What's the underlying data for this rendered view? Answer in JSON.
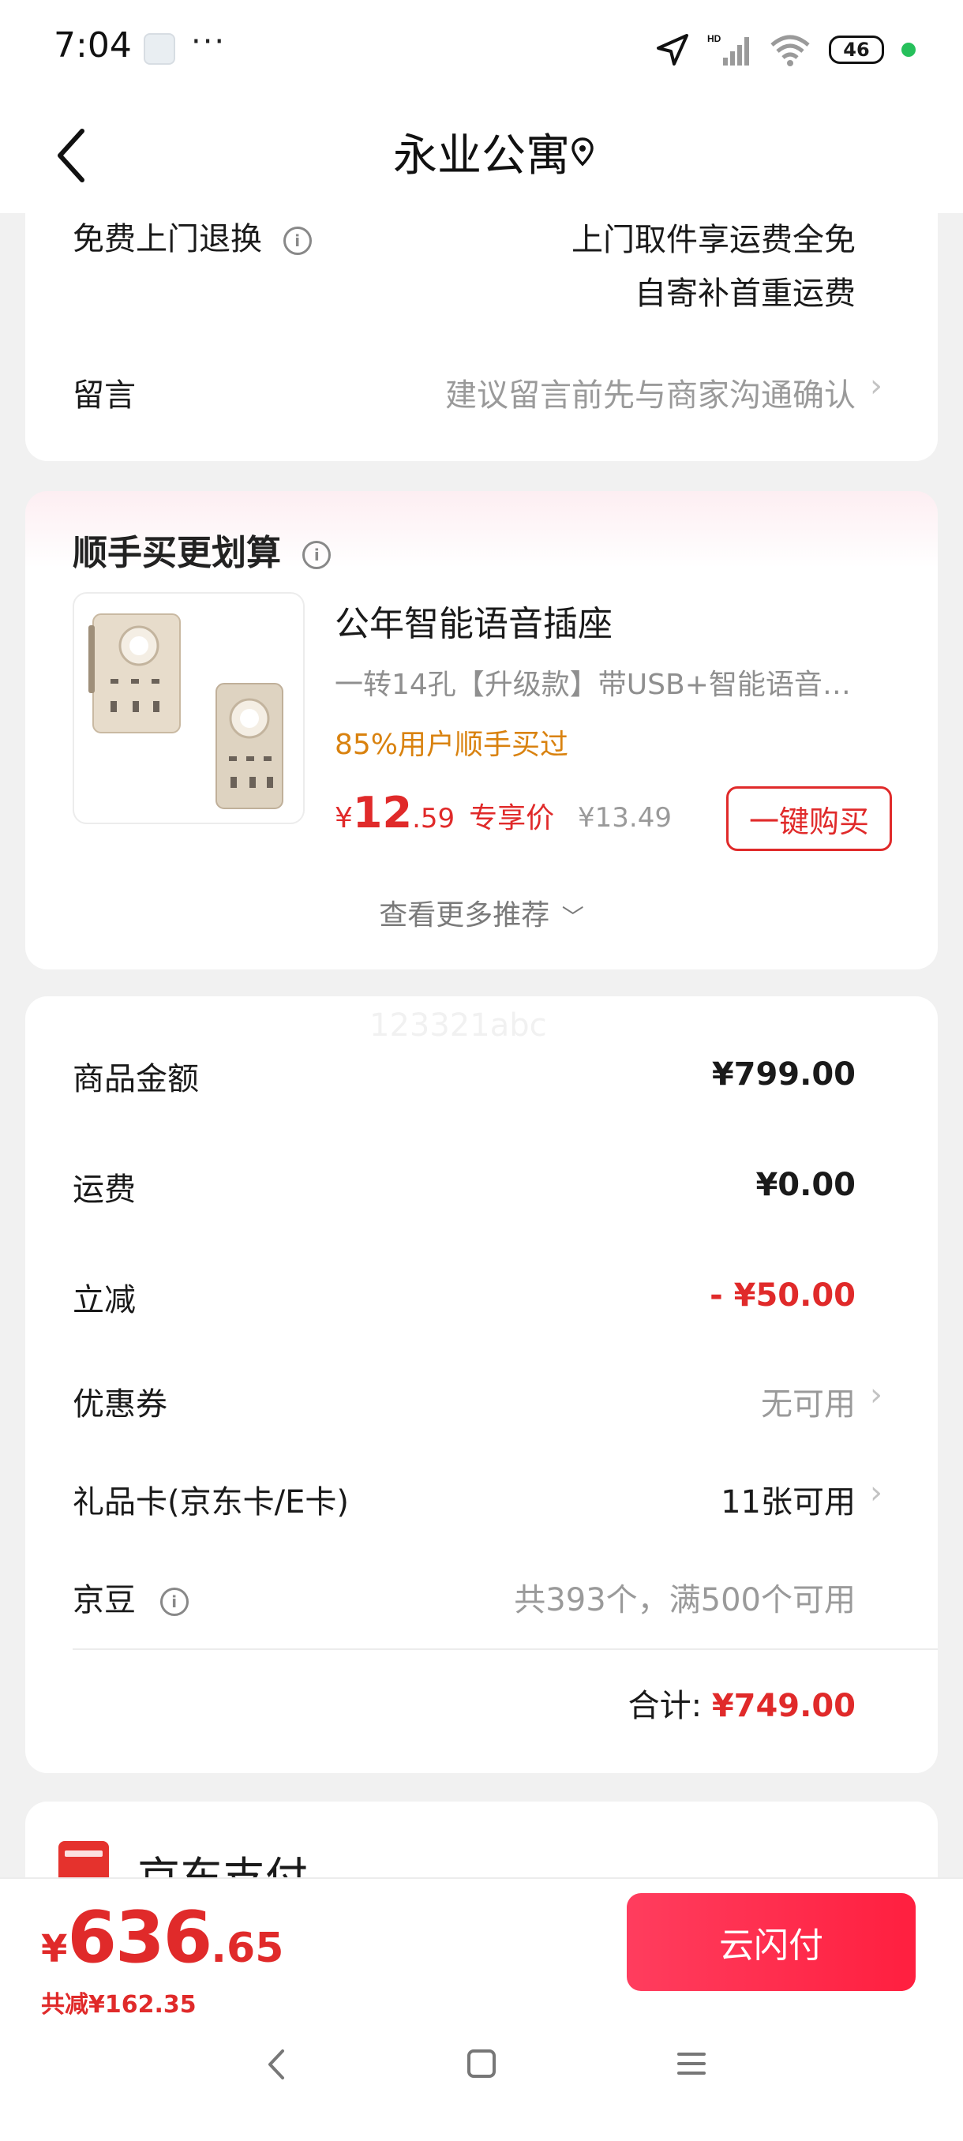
{
  "status_bar": {
    "time": "7:04",
    "more": "···",
    "battery": "46"
  },
  "header": {
    "title": "永业公寓",
    "back_icon": "chevron-left-icon",
    "location_icon": "location-pin-icon"
  },
  "service": {
    "return_label": "免费上门退换",
    "return_desc_line1": "上门取件享运费全免",
    "return_desc_line2": "自寄补首重运费",
    "message_label": "留言",
    "message_placeholder": "建议留言前先与商家沟通确认"
  },
  "recommend": {
    "title": "顺手买更划算",
    "product_name": "公年智能语音插座",
    "product_desc": "一转14孔【升级款】带USB+智能语音…",
    "product_tag": "85%用户顺手买过",
    "price_symbol": "¥",
    "price_int": "12",
    "price_dec": ".59",
    "price_tag": "专享价",
    "original_price": "¥13.49",
    "buy_button": "一键购买",
    "see_more": "查看更多推荐"
  },
  "summary": {
    "watermark": "123321abc",
    "rows": [
      {
        "label": "商品金额",
        "value": "¥799.00"
      },
      {
        "label": "运费",
        "value": "¥0.00"
      },
      {
        "label": "立减",
        "value": "- ¥50.00"
      },
      {
        "label": "优惠券",
        "value": "无可用"
      },
      {
        "label": "礼品卡(京东卡/E卡)",
        "value": "11张可用"
      },
      {
        "label": "京豆",
        "value": "共393个，满500个可用"
      }
    ],
    "total_label": "合计:",
    "total_value": "¥749.00"
  },
  "payment": {
    "label": "京东支付"
  },
  "bottom": {
    "price_symbol": "¥",
    "price_int": "636",
    "price_dec": ".65",
    "discount": "共减¥162.35",
    "pay_button": "云闪付"
  },
  "colors": {
    "accent_red": "#e02a2a",
    "orange": "#d9820f"
  }
}
